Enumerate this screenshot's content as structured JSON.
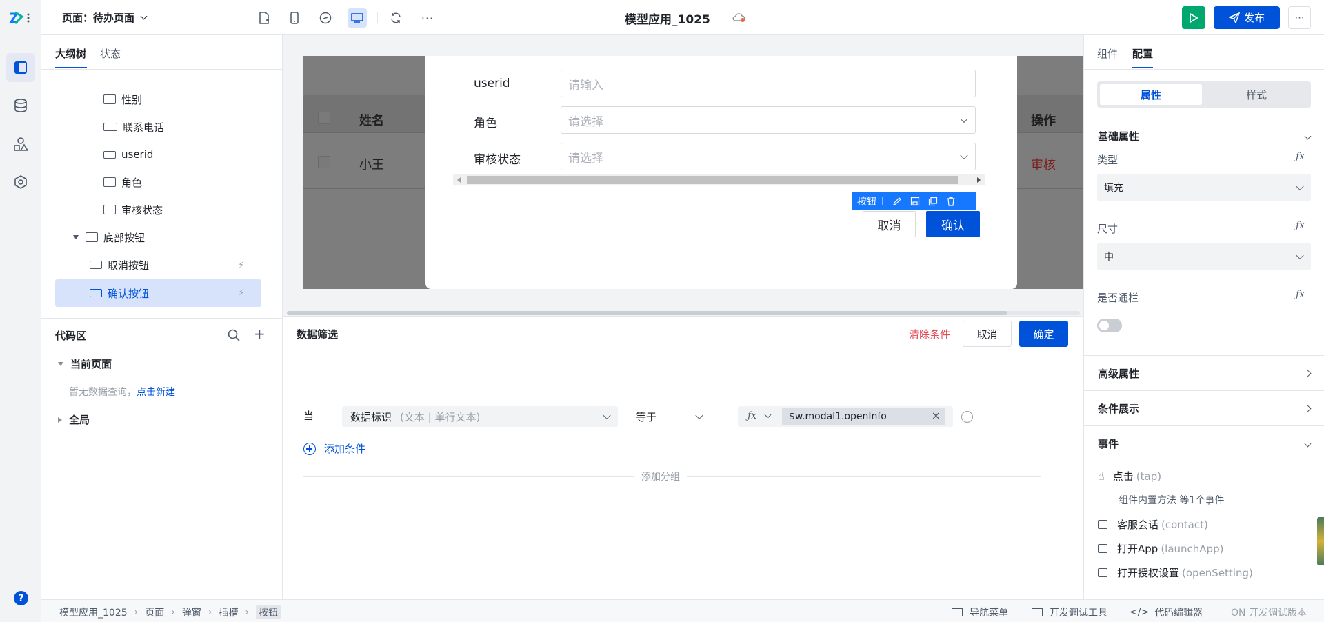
{
  "topbar": {
    "page_label": "页面：待办页面",
    "app_title": "模型应用_1025",
    "publish_label": "发布"
  },
  "left": {
    "tabs": [
      "大纲树",
      "状态"
    ],
    "tree": [
      {
        "label": "性别",
        "icon": "select-icon"
      },
      {
        "label": "联系电话",
        "icon": "number-input-icon"
      },
      {
        "label": "userid",
        "icon": "input-icon"
      },
      {
        "label": "角色",
        "icon": "select-icon"
      },
      {
        "label": "审核状态",
        "icon": "select-icon"
      },
      {
        "label": "底部按钮",
        "icon": "container-icon"
      },
      {
        "label": "取消按钮",
        "icon": "button-icon"
      },
      {
        "label": "确认按钮",
        "icon": "button-icon"
      }
    ],
    "code_area": {
      "title": "代码区",
      "current_page": "当前页面",
      "empty_text": "暂无数据查询，",
      "create_link": "点击新建",
      "global": "全局"
    }
  },
  "canvas": {
    "table": {
      "columns": [
        "姓名",
        "操作"
      ],
      "row": {
        "name": "小王",
        "action": "审核"
      }
    },
    "form": [
      {
        "label": "userid",
        "placeholder": "请输入",
        "type": "input"
      },
      {
        "label": "角色",
        "placeholder": "请选择",
        "type": "select"
      },
      {
        "label": "审核状态",
        "placeholder": "请选择",
        "type": "select"
      }
    ],
    "toolbar_label": "按钮",
    "cancel_label": "取消",
    "confirm_label": "确认"
  },
  "filter": {
    "title": "数据筛选",
    "clear_label": "清除条件",
    "cancel_label": "取消",
    "ok_label": "确定",
    "when_label": "当",
    "field": "数据标识",
    "field_type": "(文本 | 单行文本)",
    "operator": "等于",
    "value": "$w.modal1.openInfo",
    "add_condition": "添加条件",
    "add_group": "添加分组"
  },
  "right": {
    "tabs": [
      "组件",
      "配置"
    ],
    "segments": [
      "属性",
      "样式"
    ],
    "basic_title": "基础属性",
    "type_label": "类型",
    "type_value": "填充",
    "size_label": "尺寸",
    "size_value": "中",
    "banner_label": "是否通栏",
    "advanced_title": "高级属性",
    "condition_title": "条件展示",
    "events_title": "事件",
    "events": [
      {
        "name": "点击",
        "code": "(tap)"
      },
      {
        "name": "客服会话",
        "code": "(contact)"
      },
      {
        "name": "打开App",
        "code": "(launchApp)"
      },
      {
        "name": "打开授权设置",
        "code": "(openSetting)"
      }
    ],
    "event_detail": "组件内置方法 等1个事件"
  },
  "statusbar": {
    "breadcrumb": [
      "模型应用_1025",
      "页面",
      "弹窗",
      "插槽",
      "按钮"
    ],
    "nav_menu": "导航菜单",
    "dev_tools": "开发调试工具",
    "code_editor": "代码编辑器",
    "version": "ON 开发调试版本"
  },
  "colors": {
    "primary": "#0052d9",
    "run": "#00a870",
    "danger": "#e34d59"
  }
}
